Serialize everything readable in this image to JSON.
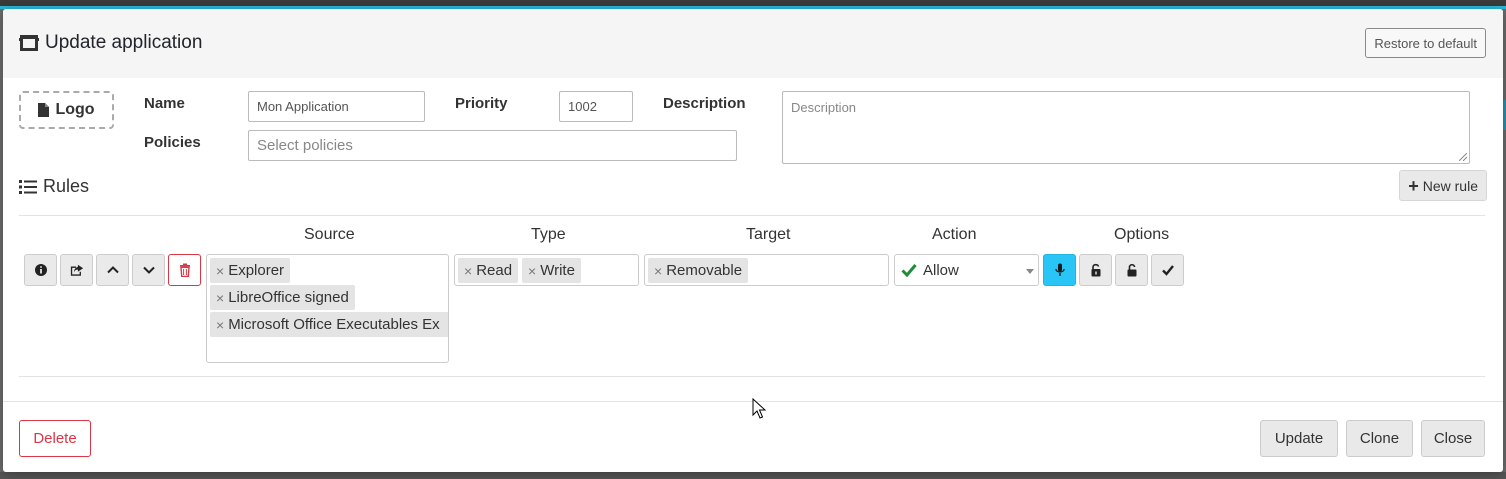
{
  "dialog": {
    "title": "Update application",
    "restore_label": "Restore to default"
  },
  "form": {
    "logo_label": "Logo",
    "name_label": "Name",
    "name_value": "Mon Application",
    "priority_label": "Priority",
    "priority_value": "1002",
    "description_label": "Description",
    "description_placeholder": "Description",
    "policies_label": "Policies",
    "policies_placeholder": "Select policies"
  },
  "rules": {
    "heading": "Rules",
    "new_rule_label": "New rule",
    "columns": {
      "source": "Source",
      "type": "Type",
      "target": "Target",
      "action": "Action",
      "options": "Options"
    },
    "row": {
      "source_tags": [
        "Explorer",
        "LibreOffice signed",
        "Microsoft Office Executables Ex"
      ],
      "type_tags": [
        "Read",
        "Write"
      ],
      "target_tags": [
        "Removable"
      ],
      "action_value": "Allow",
      "tag_remove_glyph": "×"
    }
  },
  "footer": {
    "delete_label": "Delete",
    "update_label": "Update",
    "clone_label": "Clone",
    "close_label": "Close"
  },
  "colors": {
    "danger": "#dc3545",
    "info_active": "#29c5f6",
    "allow_check": "#1e8c3a",
    "header_bg": "#f5f5f5"
  },
  "icons": {
    "title": "window-icon",
    "logo": "file-icon",
    "rules": "list-icon",
    "new_rule": "plus-icon",
    "rule_buttons": [
      "info-icon",
      "share-icon",
      "chevron-up-icon",
      "chevron-down-icon",
      "trash-icon"
    ],
    "options": [
      "microphone-icon",
      "unlock-alt-icon",
      "unlock-icon",
      "check-icon"
    ]
  }
}
